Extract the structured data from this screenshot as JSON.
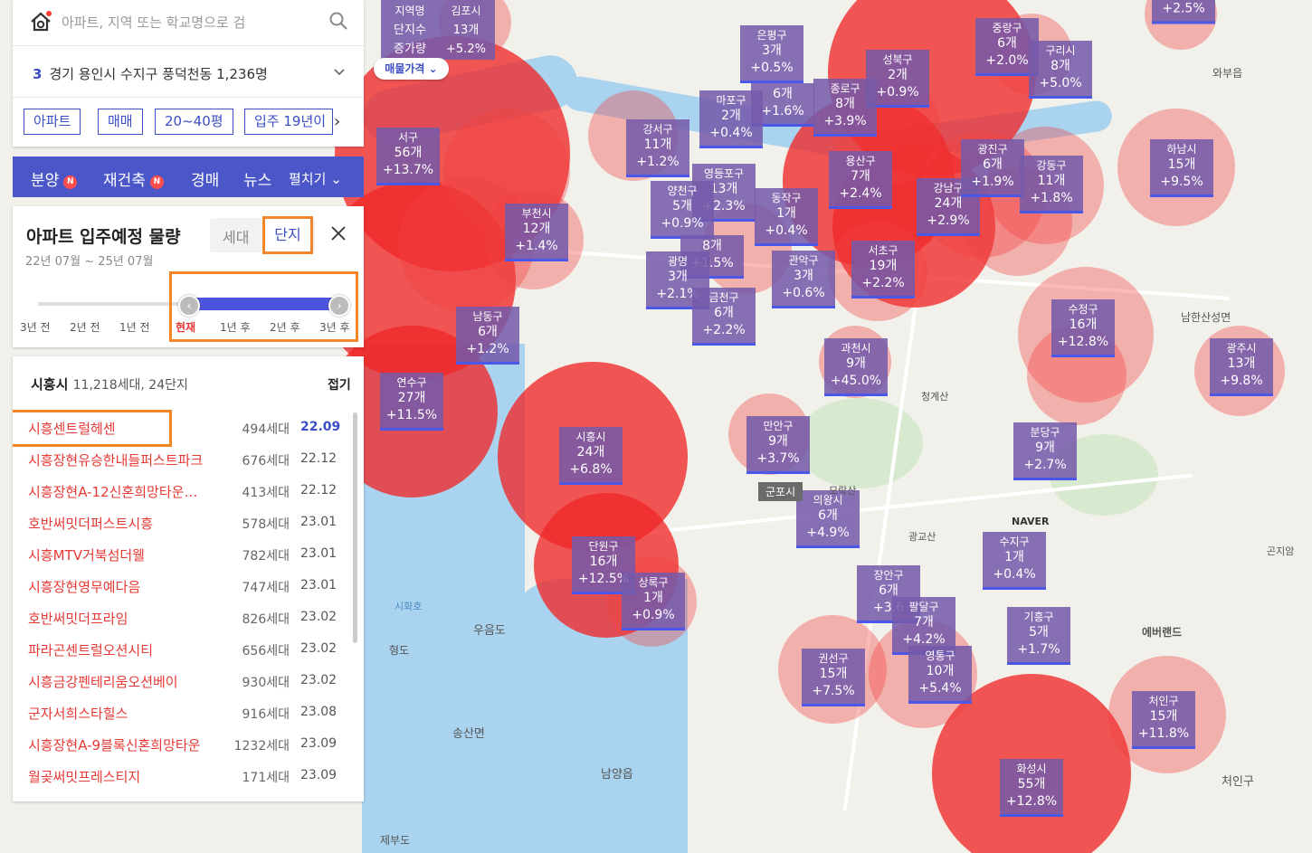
{
  "search": {
    "placeholder": "아파트, 지역 또는 학교명으로 검"
  },
  "location": {
    "count": "3",
    "text": "경기 용인시 수지구 풍덕천동 1,236명"
  },
  "filters": [
    "아파트",
    "매매",
    "20~40평",
    "입주 19년이"
  ],
  "nav": [
    {
      "label": "분양",
      "badge": "N"
    },
    {
      "label": "재건축",
      "badge": "N"
    },
    {
      "label": "경매"
    },
    {
      "label": "뉴스"
    },
    {
      "label": "펼치기"
    }
  ],
  "supply": {
    "title": "아파트 입주예정 물량",
    "range": "22년 07월 ~ 25년 07월",
    "toggle": {
      "opt1": "세대",
      "opt2": "단지"
    },
    "ticks": [
      "3년 전",
      "2년 전",
      "1년 전",
      "현재",
      "1년 후",
      "2년 후",
      "3년 후"
    ]
  },
  "list": {
    "city": "시흥시",
    "summary": "11,218세대, 24단지",
    "fold": "접기",
    "rows": [
      {
        "name": "시흥센트럴헤센",
        "households": "494세대",
        "date": "22.09"
      },
      {
        "name": "시흥장현유승한내들퍼스트파크",
        "households": "676세대",
        "date": "22.12"
      },
      {
        "name": "시흥장현A-12신혼희망타운…",
        "households": "413세대",
        "date": "22.12"
      },
      {
        "name": "호반써밋더퍼스트시흥",
        "households": "578세대",
        "date": "23.01"
      },
      {
        "name": "시흥MTV거북섬더웰",
        "households": "782세대",
        "date": "23.01"
      },
      {
        "name": "시흥장현영무예다음",
        "households": "747세대",
        "date": "23.01"
      },
      {
        "name": "호반써밋더프라임",
        "households": "826세대",
        "date": "23.02"
      },
      {
        "name": "파라곤센트럴오션시티",
        "households": "656세대",
        "date": "23.02"
      },
      {
        "name": "시흥금강펜테리움오션베이",
        "households": "930세대",
        "date": "23.02"
      },
      {
        "name": "군자서희스타힐스",
        "households": "916세대",
        "date": "23.08"
      },
      {
        "name": "시흥장현A-9블록신혼희망타운",
        "households": "1232세대",
        "date": "23.09"
      },
      {
        "name": "월곶써밋프레스티지",
        "households": "171세대",
        "date": "23.09"
      }
    ]
  },
  "legend": {
    "c1": [
      "지역명",
      "단지수",
      "증가량"
    ],
    "c2": [
      "김포시",
      "13개",
      "+5.2%"
    ],
    "price": "매물가격"
  },
  "markers": [
    {
      "name": "은평구",
      "count": "3개",
      "pct": "+0.5%"
    },
    {
      "name": "",
      "count": "6개",
      "pct": "+1.6%"
    },
    {
      "name": "마포구",
      "count": "2개",
      "pct": "+0.4%"
    },
    {
      "name": "강서구",
      "count": "11개",
      "pct": "+1.2%"
    },
    {
      "name": "성북구",
      "count": "2개",
      "pct": "+0.9%"
    },
    {
      "name": "종로구",
      "count": "8개",
      "pct": "+3.9%"
    },
    {
      "name": "중랑구",
      "count": "6개",
      "pct": "+2.0%"
    },
    {
      "name": "구리시",
      "count": "8개",
      "pct": "+5.0%"
    },
    {
      "name": "",
      "count": "",
      "pct": "+2.5%"
    },
    {
      "name": "서구",
      "count": "56개",
      "pct": "+13.7%"
    },
    {
      "name": "영등포구",
      "count": "13개",
      "pct": "+2.3%"
    },
    {
      "name": "양천구",
      "count": "5개",
      "pct": "+0.9%"
    },
    {
      "name": "동작구",
      "count": "1개",
      "pct": "+0.4%"
    },
    {
      "name": "용산구",
      "count": "7개",
      "pct": "+2.4%"
    },
    {
      "name": "강남구",
      "count": "24개",
      "pct": "+2.9%"
    },
    {
      "name": "광진구",
      "count": "6개",
      "pct": "+1.9%"
    },
    {
      "name": "강동구",
      "count": "11개",
      "pct": "+1.8%"
    },
    {
      "name": "하남시",
      "count": "15개",
      "pct": "+9.5%"
    },
    {
      "name": "부천시",
      "count": "12개",
      "pct": "+1.4%"
    },
    {
      "name": "",
      "count": "8개",
      "pct": "+1.5%"
    },
    {
      "name": "관악구",
      "count": "3개",
      "pct": "+0.6%"
    },
    {
      "name": "서초구",
      "count": "19개",
      "pct": "+2.2%"
    },
    {
      "name": "수정구",
      "count": "16개",
      "pct": "+12.8%"
    },
    {
      "name": "광명",
      "count": "3개",
      "pct": "+2.1%"
    },
    {
      "name": "금천구",
      "count": "6개",
      "pct": "+2.2%"
    },
    {
      "name": "남동구",
      "count": "6개",
      "pct": "+1.2%"
    },
    {
      "name": "광주시",
      "count": "13개",
      "pct": "+9.8%"
    },
    {
      "name": "과천시",
      "count": "9개",
      "pct": "+45.0%"
    },
    {
      "name": "연수구",
      "count": "27개",
      "pct": "+11.5%"
    },
    {
      "name": "분당구",
      "count": "9개",
      "pct": "+2.7%"
    },
    {
      "name": "시흥시",
      "count": "24개",
      "pct": "+6.8%"
    },
    {
      "name": "만안구",
      "count": "9개",
      "pct": "+3.7%"
    },
    {
      "name": "의왕시",
      "count": "6개",
      "pct": "+4.9%"
    },
    {
      "name": "단원구",
      "count": "16개",
      "pct": "+12.5%"
    },
    {
      "name": "상록구",
      "count": "1개",
      "pct": "+0.9%"
    },
    {
      "name": "수지구",
      "count": "1개",
      "pct": "+0.4%"
    },
    {
      "name": "장안구",
      "count": "6개",
      "pct": "+3.6"
    },
    {
      "name": "팔달구",
      "count": "7개",
      "pct": "+4.2%"
    },
    {
      "name": "기흥구",
      "count": "5개",
      "pct": "+1.7%"
    },
    {
      "name": "권선구",
      "count": "15개",
      "pct": "+7.5%"
    },
    {
      "name": "영통구",
      "count": "10개",
      "pct": "+5.4%"
    },
    {
      "name": "처인구",
      "count": "15개",
      "pct": "+11.8%"
    },
    {
      "name": "화성시",
      "count": "55개",
      "pct": "+12.8%"
    }
  ],
  "map_labels": [
    "군포시",
    "NAVER",
    "송산면",
    "처인구",
    "남양읍",
    "우음도",
    "형도",
    "시화호",
    "제부도",
    "에버랜드",
    "곤지암",
    "남한산성면",
    "청계산",
    "모락산",
    "광교산",
    "와부읍"
  ]
}
